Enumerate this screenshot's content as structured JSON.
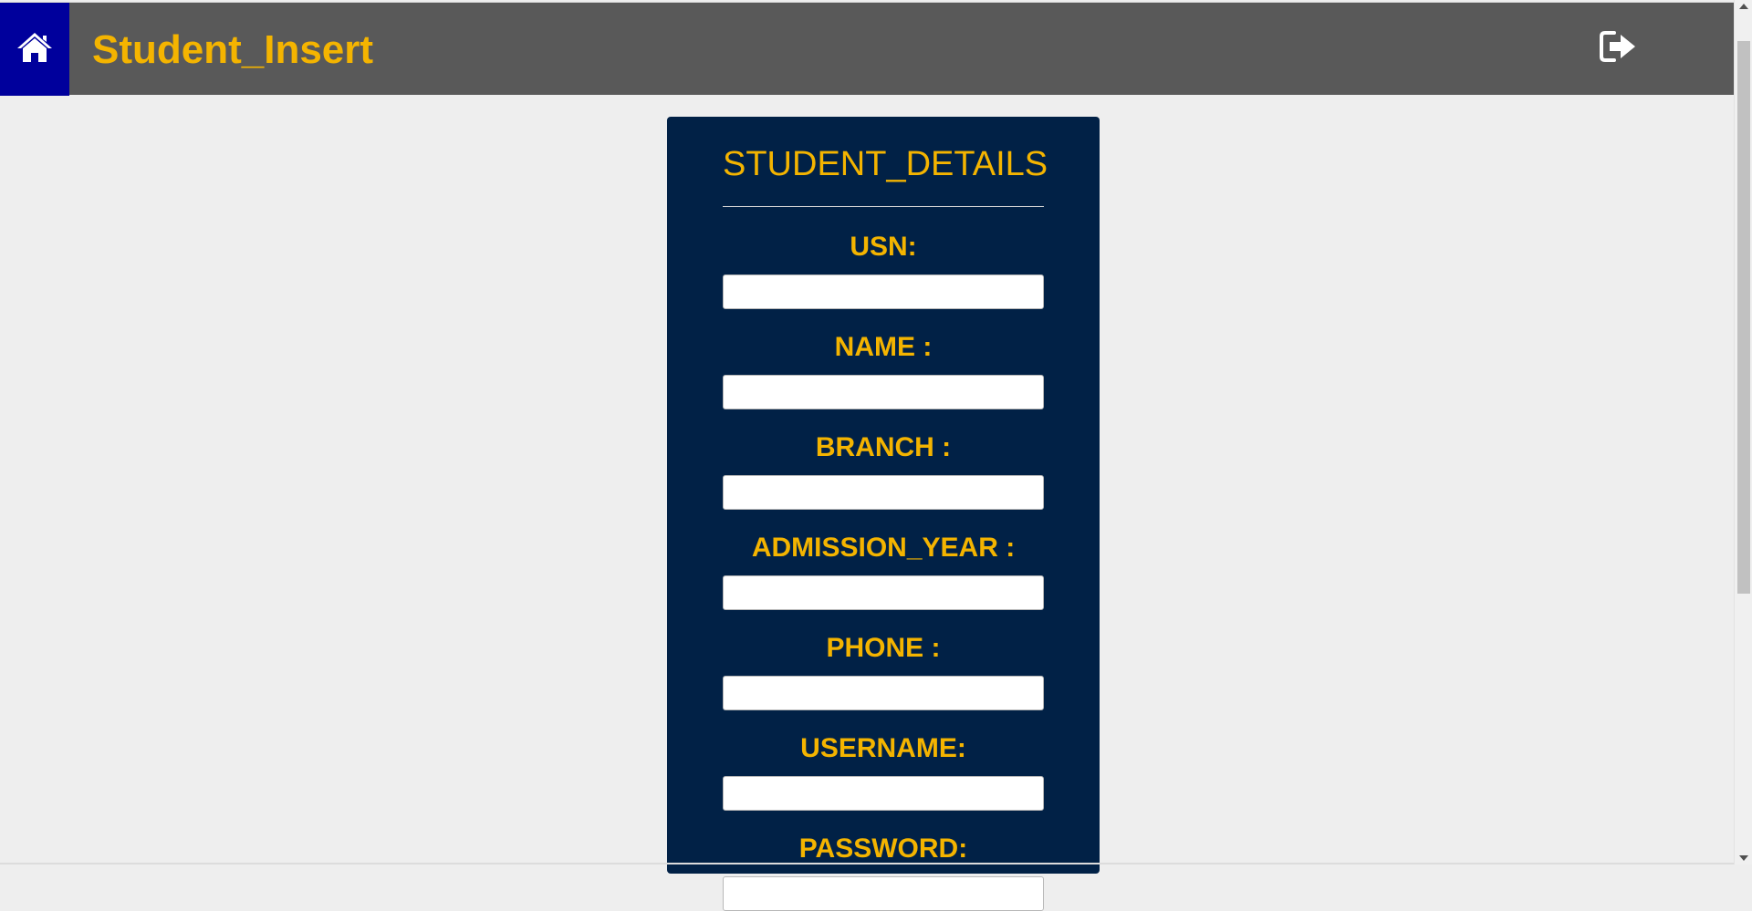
{
  "header": {
    "title": "Student_Insert",
    "home_icon": "home-icon",
    "logout_icon": "sign-out-icon"
  },
  "form": {
    "heading": "STUDENT_DETAILS",
    "fields": [
      {
        "label": "USN:",
        "value": ""
      },
      {
        "label": "NAME :",
        "value": ""
      },
      {
        "label": "BRANCH :",
        "value": ""
      },
      {
        "label": "ADMISSION_YEAR :",
        "value": ""
      },
      {
        "label": "PHONE :",
        "value": ""
      },
      {
        "label": "USERNAME:",
        "value": ""
      },
      {
        "label": "PASSWORD:",
        "value": ""
      }
    ]
  },
  "colors": {
    "header_bg": "#595959",
    "home_bg": "#00009c",
    "accent": "#f4b400",
    "panel_bg": "#012146",
    "page_bg": "#eeeeee"
  }
}
